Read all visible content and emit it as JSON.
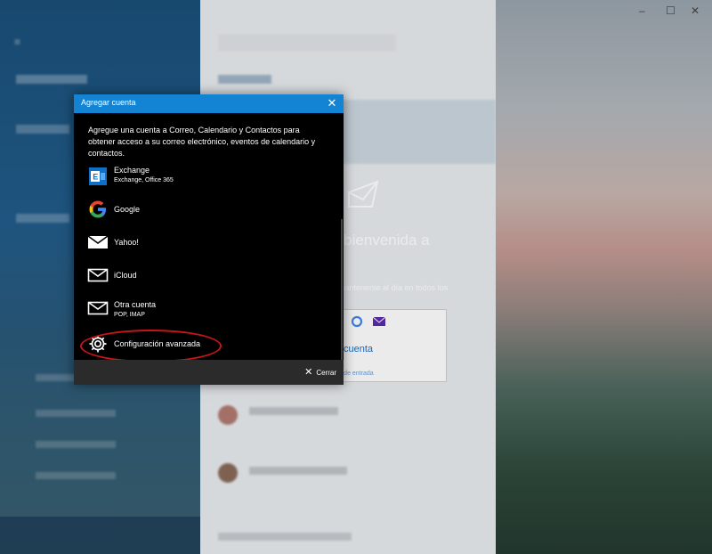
{
  "dialog": {
    "title": "Agregar cuenta",
    "close_glyph": "✕",
    "description": "Agregue una cuenta a Correo, Calendario y Contactos para obtener acceso a su correo electrónico, eventos de calendario y contactos.",
    "accounts": [
      {
        "name": "Exchange",
        "subtitle": "Exchange, Office 365",
        "icon": "exchange-icon"
      },
      {
        "name": "Google",
        "subtitle": "",
        "icon": "google-icon"
      },
      {
        "name": "Yahoo!",
        "subtitle": "",
        "icon": "mail-icon"
      },
      {
        "name": "iCloud",
        "subtitle": "",
        "icon": "mail-icon"
      },
      {
        "name": "Otra cuenta",
        "subtitle": "POP, IMAP",
        "icon": "mail-icon"
      },
      {
        "name": "Configuración avanzada",
        "subtitle": "",
        "icon": "gear-icon"
      }
    ],
    "footer": {
      "close_label": "Cerrar"
    }
  },
  "background": {
    "welcome_title": "a bienvenida a",
    "welcome_text": "mantenerse al día en todos los",
    "card_link": "cuenta",
    "card_sub": "deja de entrada"
  },
  "window": {
    "minimize": "–",
    "maximize": "☐",
    "close": "✕"
  },
  "colors": {
    "accent": "#1383d3",
    "annotation": "#c8151b"
  }
}
